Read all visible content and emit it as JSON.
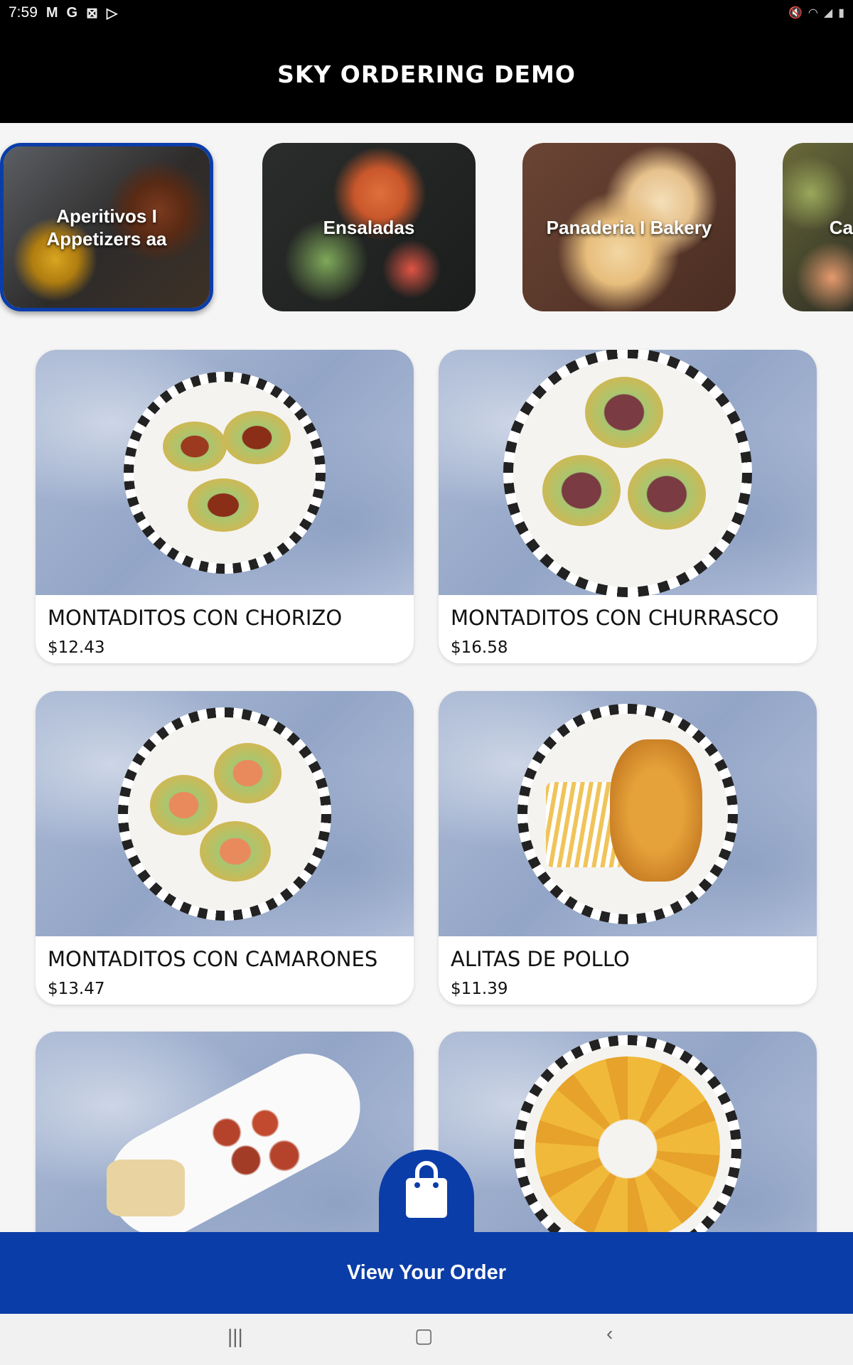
{
  "status_bar": {
    "time": "7:59",
    "left_icons": [
      "gmail-icon",
      "google-icon",
      "x-icon",
      "play-icon"
    ],
    "right_icons": [
      "mute-icon",
      "wifi-icon",
      "signal-icon",
      "battery-icon"
    ]
  },
  "header": {
    "title": "SKY ORDERING DEMO"
  },
  "categories": [
    {
      "label": "Aperitivos I Appetizers aa",
      "selected": true
    },
    {
      "label": "Ensaladas",
      "selected": false
    },
    {
      "label": "Panaderia I Bakery",
      "selected": false
    },
    {
      "label": "Ca",
      "selected": false
    }
  ],
  "products": [
    {
      "name": "MONTADITOS CON CHORIZO",
      "price": "$12.43"
    },
    {
      "name": "MONTADITOS CON CHURRASCO",
      "price": "$16.58"
    },
    {
      "name": "MONTADITOS CON CAMARONES",
      "price": "$13.47"
    },
    {
      "name": "ALITAS DE POLLO",
      "price": "$11.39"
    },
    {
      "name": "",
      "price": ""
    },
    {
      "name": "",
      "price": ""
    }
  ],
  "order_bar": {
    "label": "View Your Order"
  },
  "nav": {
    "recent": "recent-apps-icon",
    "home": "home-icon",
    "back": "back-icon"
  },
  "colors": {
    "primary": "#0b3da8",
    "header_bg": "#000000"
  }
}
